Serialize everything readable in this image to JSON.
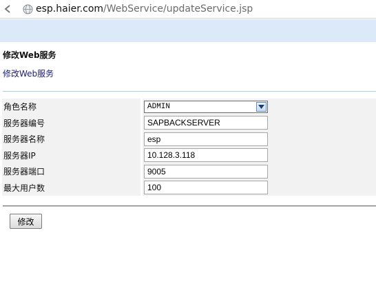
{
  "browser": {
    "url_host": "esp.haier.com",
    "url_path": "/WebService/updateService.jsp"
  },
  "page": {
    "heading": "修改Web服务",
    "subheading": "修改Web服务"
  },
  "form": {
    "role": {
      "label": "角色名称",
      "value": "ADMIN"
    },
    "server_code": {
      "label": "服务器编号",
      "value": "SAPBACKSERVER"
    },
    "server_name": {
      "label": "服务器名称",
      "value": "esp"
    },
    "server_ip": {
      "label": "服务器IP",
      "value": "10.128.3.118"
    },
    "server_port": {
      "label": "服务器端口",
      "value": "9005"
    },
    "max_users": {
      "label": "最大用户数",
      "value": "100"
    }
  },
  "actions": {
    "submit_label": "修改"
  }
}
